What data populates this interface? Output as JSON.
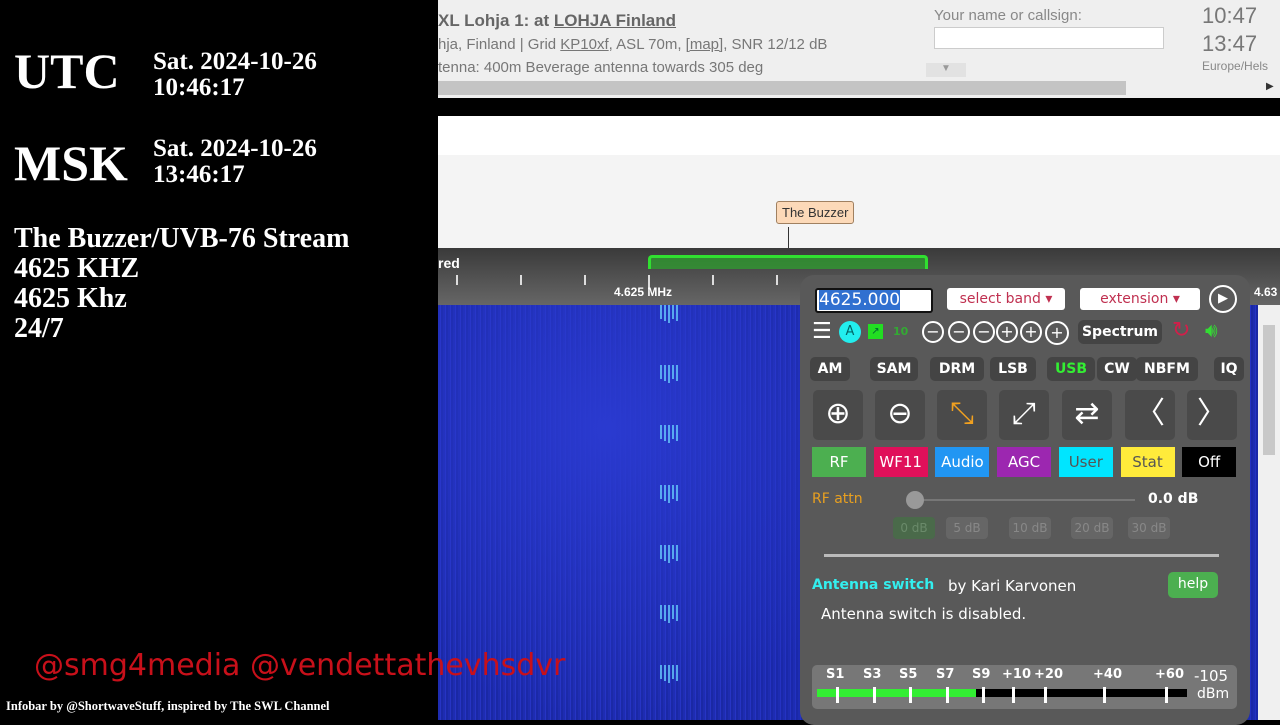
{
  "overlay": {
    "zones": [
      {
        "name": "UTC",
        "date": "Sat. 2024-10-26",
        "time": "10:46:17"
      },
      {
        "name": "MSK",
        "date": "Sat. 2024-10-26",
        "time": "13:46:17"
      }
    ],
    "info": [
      "The Buzzer/UVB-76 Stream",
      "4625 KHZ",
      "4625 Khz",
      "24/7"
    ],
    "handles": "@smg4media @vendettathevhsdvr",
    "infobar": "Infobar by @ShortwaveStuff, inspired by The SWL Channel"
  },
  "header": {
    "title_prefix": "XL Lohja 1: at ",
    "title_link": "LOHJA Finland",
    "line2_prefix": "hja, Finland | Grid ",
    "grid": "KP10xf",
    "line2_mid": ", ASL 70m, ",
    "map": "[map]",
    "line2_suffix": ", SNR 12/12 dB",
    "line3": "tenna: 400m Beverage antenna towards 305 deg",
    "callsign_label": "Your name or callsign:",
    "callsign_value": "",
    "clock1": "10:47",
    "clock2": "13:47",
    "timezone": "Europe/Hels",
    "dropdown_arrow": "▼",
    "scroll_arrow": "▶"
  },
  "spectrum": {
    "label_left": "red",
    "marker": "The Buzzer",
    "freq_label": "4.625 MHz",
    "freq_label_right": "4.63"
  },
  "panel": {
    "frequency": "4625.000",
    "band": "select band ▾",
    "extension": "extension ▾",
    "zoom_level": "10",
    "spectrum": "Spectrum",
    "modes": [
      "AM",
      "SAM",
      "DRM",
      "LSB",
      "USB",
      "CW",
      "NBFM",
      "IQ"
    ],
    "active_mode": "USB",
    "tabs": [
      "RF",
      "WF11",
      "Audio",
      "AGC",
      "User",
      "Stat",
      "Off"
    ],
    "tab_colors": [
      "#4caf50",
      "#e0105a",
      "#2196f3",
      "#9c27b0",
      "#00e5ff",
      "#ffeb3b",
      "#000000"
    ],
    "rf_attn_label": "RF attn",
    "rf_attn_value": "0.0 dB",
    "rf_attn_level": 0,
    "attn_buttons": [
      "0 dB",
      "5 dB",
      "10 dB",
      "20 dB",
      "30 dB"
    ],
    "antenna_title": "Antenna switch",
    "antenna_author": "by Kari Karvonen",
    "help": "help",
    "antenna_status": "Antenna switch is disabled.",
    "smeter_labels": [
      "S1",
      "S3",
      "S5",
      "S7",
      "S9",
      "+10",
      "+20",
      "+40",
      "+60"
    ],
    "smeter_dbm": "-105",
    "smeter_unit": "dBm",
    "smeter_level_dbm": -105
  }
}
